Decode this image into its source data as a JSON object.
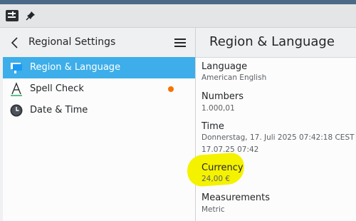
{
  "window": {
    "colors": {
      "accent": "#3daee9",
      "badge": "#f67400",
      "highlight": "#f5f200"
    }
  },
  "sidebar": {
    "title": "Regional Settings",
    "items": [
      {
        "label": "Region & Language",
        "icon": "region-flag-icon",
        "active": true
      },
      {
        "label": "Spell Check",
        "icon": "spell-check-icon",
        "badge": true
      },
      {
        "label": "Date & Time",
        "icon": "clock-icon"
      }
    ]
  },
  "main": {
    "title": "Region & Language",
    "settings": [
      {
        "title": "Language",
        "values": [
          "American English"
        ]
      },
      {
        "title": "Numbers",
        "values": [
          "1.000,01"
        ]
      },
      {
        "title": "Time",
        "values": [
          "Donnerstag, 17. Juli 2025 07:42:18 CEST",
          "17.07.25 07:42"
        ]
      },
      {
        "title": "Currency",
        "values": [
          "24,00 €"
        ],
        "highlighted": true
      },
      {
        "title": "Measurements",
        "values": [
          "Metric"
        ]
      }
    ]
  }
}
